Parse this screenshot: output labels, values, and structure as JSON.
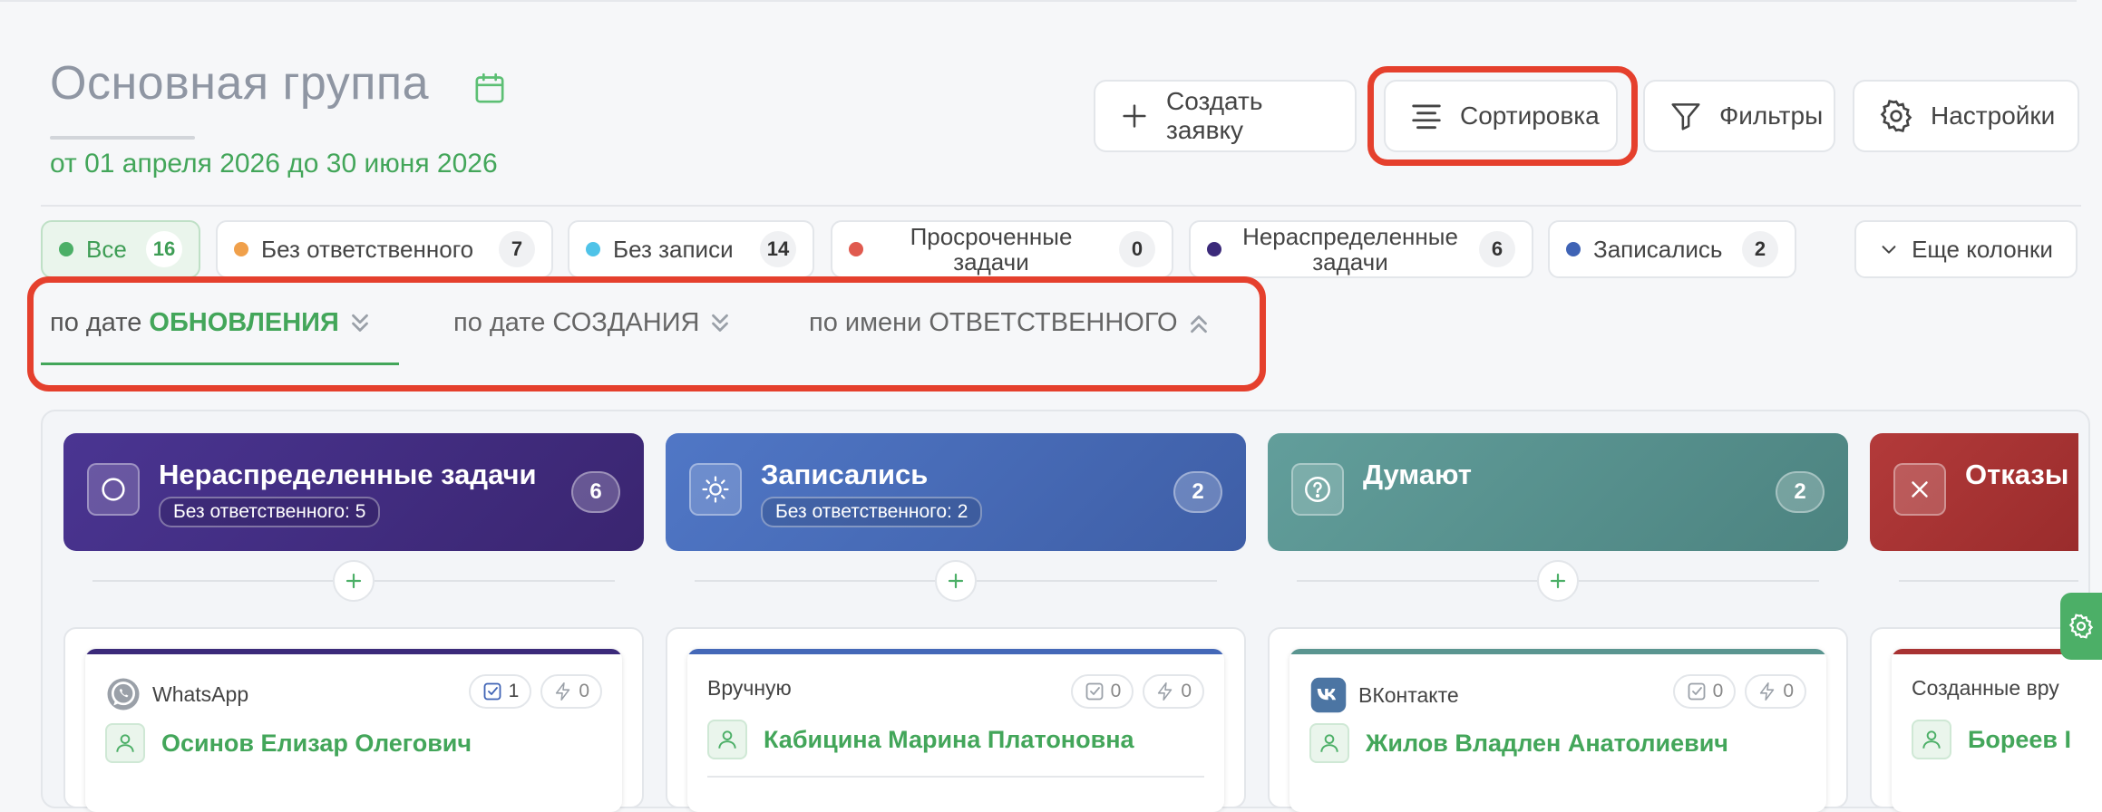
{
  "header": {
    "title": "Основная группа",
    "date_range": "от 01 апреля 2026 до 30 июня 2026"
  },
  "toolbar": {
    "create_label": "Создать заявку",
    "sort_label": "Сортировка",
    "filters_label": "Фильтры",
    "settings_label": "Настройки"
  },
  "chips": [
    {
      "label": "Все",
      "count": "16",
      "color": "#4caf67",
      "active": true
    },
    {
      "label": "Без ответственного",
      "count": "7",
      "color": "#f0a04b"
    },
    {
      "label": "Без записи",
      "count": "14",
      "color": "#4fc3e8"
    },
    {
      "label": "Просроченные задачи",
      "count": "0",
      "color": "#e05a4f"
    },
    {
      "label": "Нераспределенные задачи",
      "count": "6",
      "color": "#3b2a7a"
    },
    {
      "label": "Записались",
      "count": "2",
      "color": "#3f63b5"
    }
  ],
  "more_columns_label": "Еще колонки",
  "sort_options": [
    {
      "prefix": "по дате",
      "field": "ОБНОВЛЕНИЯ",
      "active": true,
      "direction": "desc"
    },
    {
      "prefix": "по дате",
      "field": "СОЗДАНИЯ",
      "direction": "desc"
    },
    {
      "prefix": "по имени",
      "field": "ОТВЕТСТВЕННОГО",
      "direction": "asc"
    }
  ],
  "columns": [
    {
      "name": "Нераспределенные задачи",
      "sub": "Без ответственного: 5",
      "count": "6",
      "icon": "circle-icon",
      "color_from": "#4a3592",
      "color_to": "#3a2570"
    },
    {
      "name": "Записались",
      "sub": "Без ответственного: 2",
      "count": "2",
      "icon": "sun-icon",
      "color_from": "#4e72c2",
      "color_to": "#3f5fa8"
    },
    {
      "name": "Думают",
      "sub": "",
      "count": "2",
      "icon": "question-icon",
      "color_from": "#5f9b98",
      "color_to": "#4d8582"
    },
    {
      "name": "Отказы",
      "sub": "",
      "count": "",
      "icon": "close-icon",
      "color_from": "#b33a3a",
      "color_to": "#9a2c2c"
    }
  ],
  "cards": [
    {
      "source": "WhatsApp",
      "source_icon": "whatsapp-icon",
      "tasks": "1",
      "events": "0",
      "name": "Осинов Елизар Олегович",
      "bar_color": "#3b2a7a"
    },
    {
      "source": "Вручную",
      "source_icon": "",
      "tasks": "0",
      "events": "0",
      "name": "Кабицина Марина Платоновна",
      "bar_color": "#4468b8"
    },
    {
      "source": "ВКонтакте",
      "source_icon": "vk-icon",
      "tasks": "0",
      "events": "0",
      "name": "Жилов Владлен Анатолиевич",
      "bar_color": "#5a9590"
    },
    {
      "source": "Созданные вру",
      "source_icon": "",
      "tasks": "",
      "events": "",
      "name": "Бореев I",
      "bar_color": "#a83232"
    }
  ]
}
